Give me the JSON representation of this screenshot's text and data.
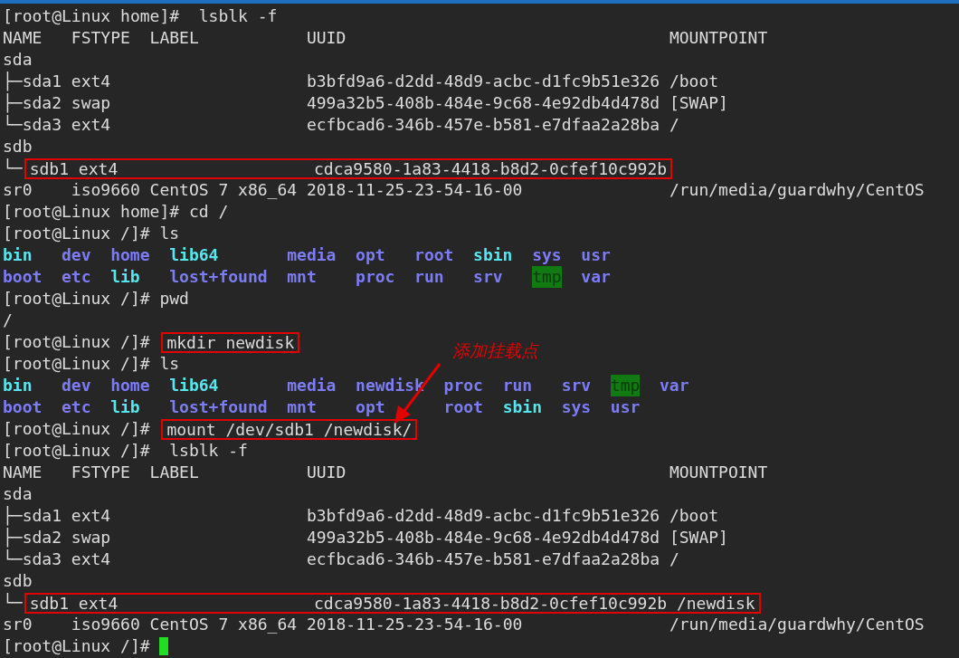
{
  "lines": [
    {
      "kind": "text",
      "segments": [
        {
          "kind": "text",
          "text": "[root@Linux home]#  lsblk -f",
          "boxed": false
        }
      ]
    },
    {
      "kind": "text",
      "segments": [
        {
          "kind": "text",
          "text": "NAME   FSTYPE  LABEL           UUID                                 MOUNTPOINT",
          "boxed": false
        }
      ]
    },
    {
      "kind": "text",
      "segments": [
        {
          "kind": "text",
          "text": "sda",
          "boxed": false
        }
      ]
    },
    {
      "kind": "text",
      "segments": [
        {
          "kind": "text",
          "text": "├─sda1 ext4                    b3bfd9a6-d2dd-48d9-acbc-d1fc9b51e326 /boot",
          "boxed": false
        }
      ]
    },
    {
      "kind": "text",
      "segments": [
        {
          "kind": "text",
          "text": "├─sda2 swap                    499a32b5-408b-484e-9c68-4e92db4d478d [SWAP]",
          "boxed": false
        }
      ]
    },
    {
      "kind": "text",
      "segments": [
        {
          "kind": "text",
          "text": "└─sda3 ext4                    ecfbcad6-346b-457e-b581-e7dfaa2a28ba /",
          "boxed": false
        }
      ]
    },
    {
      "kind": "text",
      "segments": [
        {
          "kind": "text",
          "text": "sdb",
          "boxed": false
        }
      ]
    },
    {
      "kind": "text",
      "segments": [
        {
          "kind": "text",
          "text": "└─",
          "boxed": false
        },
        {
          "kind": "text",
          "text": "sdb1 ext4                    cdca9580-1a83-4418-b8d2-0cfef10c992b",
          "boxed": true
        }
      ]
    },
    {
      "kind": "text",
      "segments": [
        {
          "kind": "text",
          "text": "sr0    iso9660 CentOS 7 x86_64 2018-11-25-23-54-16-00               /run/media/guardwhy/CentOS",
          "boxed": false
        }
      ]
    },
    {
      "kind": "text",
      "segments": [
        {
          "kind": "text",
          "text": "[root@Linux home]# cd /",
          "boxed": false
        }
      ]
    },
    {
      "kind": "text",
      "segments": [
        {
          "kind": "text",
          "text": "[root@Linux /]# ls",
          "boxed": false
        }
      ]
    },
    {
      "kind": "listing",
      "rows": [
        [
          {
            "name": "bin",
            "kind": "link"
          },
          {
            "name": "dev",
            "kind": "dir"
          },
          {
            "name": "home",
            "kind": "dir"
          },
          {
            "name": "lib64",
            "kind": "link"
          },
          {
            "name": "media",
            "kind": "dir"
          },
          {
            "name": "opt",
            "kind": "dir"
          },
          {
            "name": "root",
            "kind": "dir"
          },
          {
            "name": "sbin",
            "kind": "link"
          },
          {
            "name": "sys",
            "kind": "dir"
          },
          {
            "name": "usr",
            "kind": "dir"
          }
        ],
        [
          {
            "name": "boot",
            "kind": "dir"
          },
          {
            "name": "etc",
            "kind": "dir"
          },
          {
            "name": "lib",
            "kind": "link"
          },
          {
            "name": "lost+found",
            "kind": "dir"
          },
          {
            "name": "mnt",
            "kind": "dir"
          },
          {
            "name": "proc",
            "kind": "dir"
          },
          {
            "name": "run",
            "kind": "dir"
          },
          {
            "name": "srv",
            "kind": "dir"
          },
          {
            "name": "tmp",
            "kind": "sticky"
          },
          {
            "name": "var",
            "kind": "dir"
          }
        ]
      ]
    },
    {
      "kind": "text",
      "segments": [
        {
          "kind": "text",
          "text": "[root@Linux /]# pwd",
          "boxed": false
        }
      ]
    },
    {
      "kind": "text",
      "segments": [
        {
          "kind": "text",
          "text": "/",
          "boxed": false
        }
      ]
    },
    {
      "kind": "text",
      "segments": [
        {
          "kind": "text",
          "text": "[root@Linux /]# ",
          "boxed": false
        },
        {
          "kind": "text",
          "text": "mkdir newdisk",
          "boxed": true
        }
      ]
    },
    {
      "kind": "text",
      "segments": [
        {
          "kind": "text",
          "text": "[root@Linux /]# ls",
          "boxed": false
        }
      ]
    },
    {
      "kind": "listing",
      "rows": [
        [
          {
            "name": "bin",
            "kind": "link"
          },
          {
            "name": "dev",
            "kind": "dir"
          },
          {
            "name": "home",
            "kind": "dir"
          },
          {
            "name": "lib64",
            "kind": "link"
          },
          {
            "name": "media",
            "kind": "dir"
          },
          {
            "name": "newdisk",
            "kind": "dir"
          },
          {
            "name": "proc",
            "kind": "dir"
          },
          {
            "name": "run",
            "kind": "dir"
          },
          {
            "name": "srv",
            "kind": "dir"
          },
          {
            "name": "tmp",
            "kind": "sticky"
          },
          {
            "name": "var",
            "kind": "dir"
          }
        ],
        [
          {
            "name": "boot",
            "kind": "dir"
          },
          {
            "name": "etc",
            "kind": "dir"
          },
          {
            "name": "lib",
            "kind": "link"
          },
          {
            "name": "lost+found",
            "kind": "dir"
          },
          {
            "name": "mnt",
            "kind": "dir"
          },
          {
            "name": "opt",
            "kind": "dir"
          },
          {
            "name": "root",
            "kind": "dir"
          },
          {
            "name": "sbin",
            "kind": "link"
          },
          {
            "name": "sys",
            "kind": "dir"
          },
          {
            "name": "usr",
            "kind": "dir"
          }
        ]
      ]
    },
    {
      "kind": "text",
      "segments": [
        {
          "kind": "text",
          "text": "[root@Linux /]# ",
          "boxed": false
        },
        {
          "kind": "text",
          "text": "mount /dev/sdb1 /newdisk/",
          "boxed": true
        }
      ]
    },
    {
      "kind": "text",
      "segments": [
        {
          "kind": "text",
          "text": "[root@Linux /]#  lsblk -f",
          "boxed": false
        }
      ]
    },
    {
      "kind": "text",
      "segments": [
        {
          "kind": "text",
          "text": "NAME   FSTYPE  LABEL           UUID                                 MOUNTPOINT",
          "boxed": false
        }
      ]
    },
    {
      "kind": "text",
      "segments": [
        {
          "kind": "text",
          "text": "sda",
          "boxed": false
        }
      ]
    },
    {
      "kind": "text",
      "segments": [
        {
          "kind": "text",
          "text": "├─sda1 ext4                    b3bfd9a6-d2dd-48d9-acbc-d1fc9b51e326 /boot",
          "boxed": false
        }
      ]
    },
    {
      "kind": "text",
      "segments": [
        {
          "kind": "text",
          "text": "├─sda2 swap                    499a32b5-408b-484e-9c68-4e92db4d478d [SWAP]",
          "boxed": false
        }
      ]
    },
    {
      "kind": "text",
      "segments": [
        {
          "kind": "text",
          "text": "└─sda3 ext4                    ecfbcad6-346b-457e-b581-e7dfaa2a28ba /",
          "boxed": false
        }
      ]
    },
    {
      "kind": "text",
      "segments": [
        {
          "kind": "text",
          "text": "sdb",
          "boxed": false
        }
      ]
    },
    {
      "kind": "text",
      "segments": [
        {
          "kind": "text",
          "text": "└─",
          "boxed": false
        },
        {
          "kind": "text",
          "text": "sdb1 ext4                    cdca9580-1a83-4418-b8d2-0cfef10c992b /newdisk",
          "boxed": true
        }
      ]
    },
    {
      "kind": "text",
      "segments": [
        {
          "kind": "text",
          "text": "sr0    iso9660 CentOS 7 x86_64 2018-11-25-23-54-16-00               /run/media/guardwhy/CentOS",
          "boxed": false
        }
      ]
    },
    {
      "kind": "text",
      "segments": [
        {
          "kind": "text",
          "text": "[root@Linux /]# ",
          "boxed": false
        },
        {
          "kind": "cursor"
        }
      ]
    }
  ],
  "annotation": {
    "text": "添加挂载点"
  }
}
